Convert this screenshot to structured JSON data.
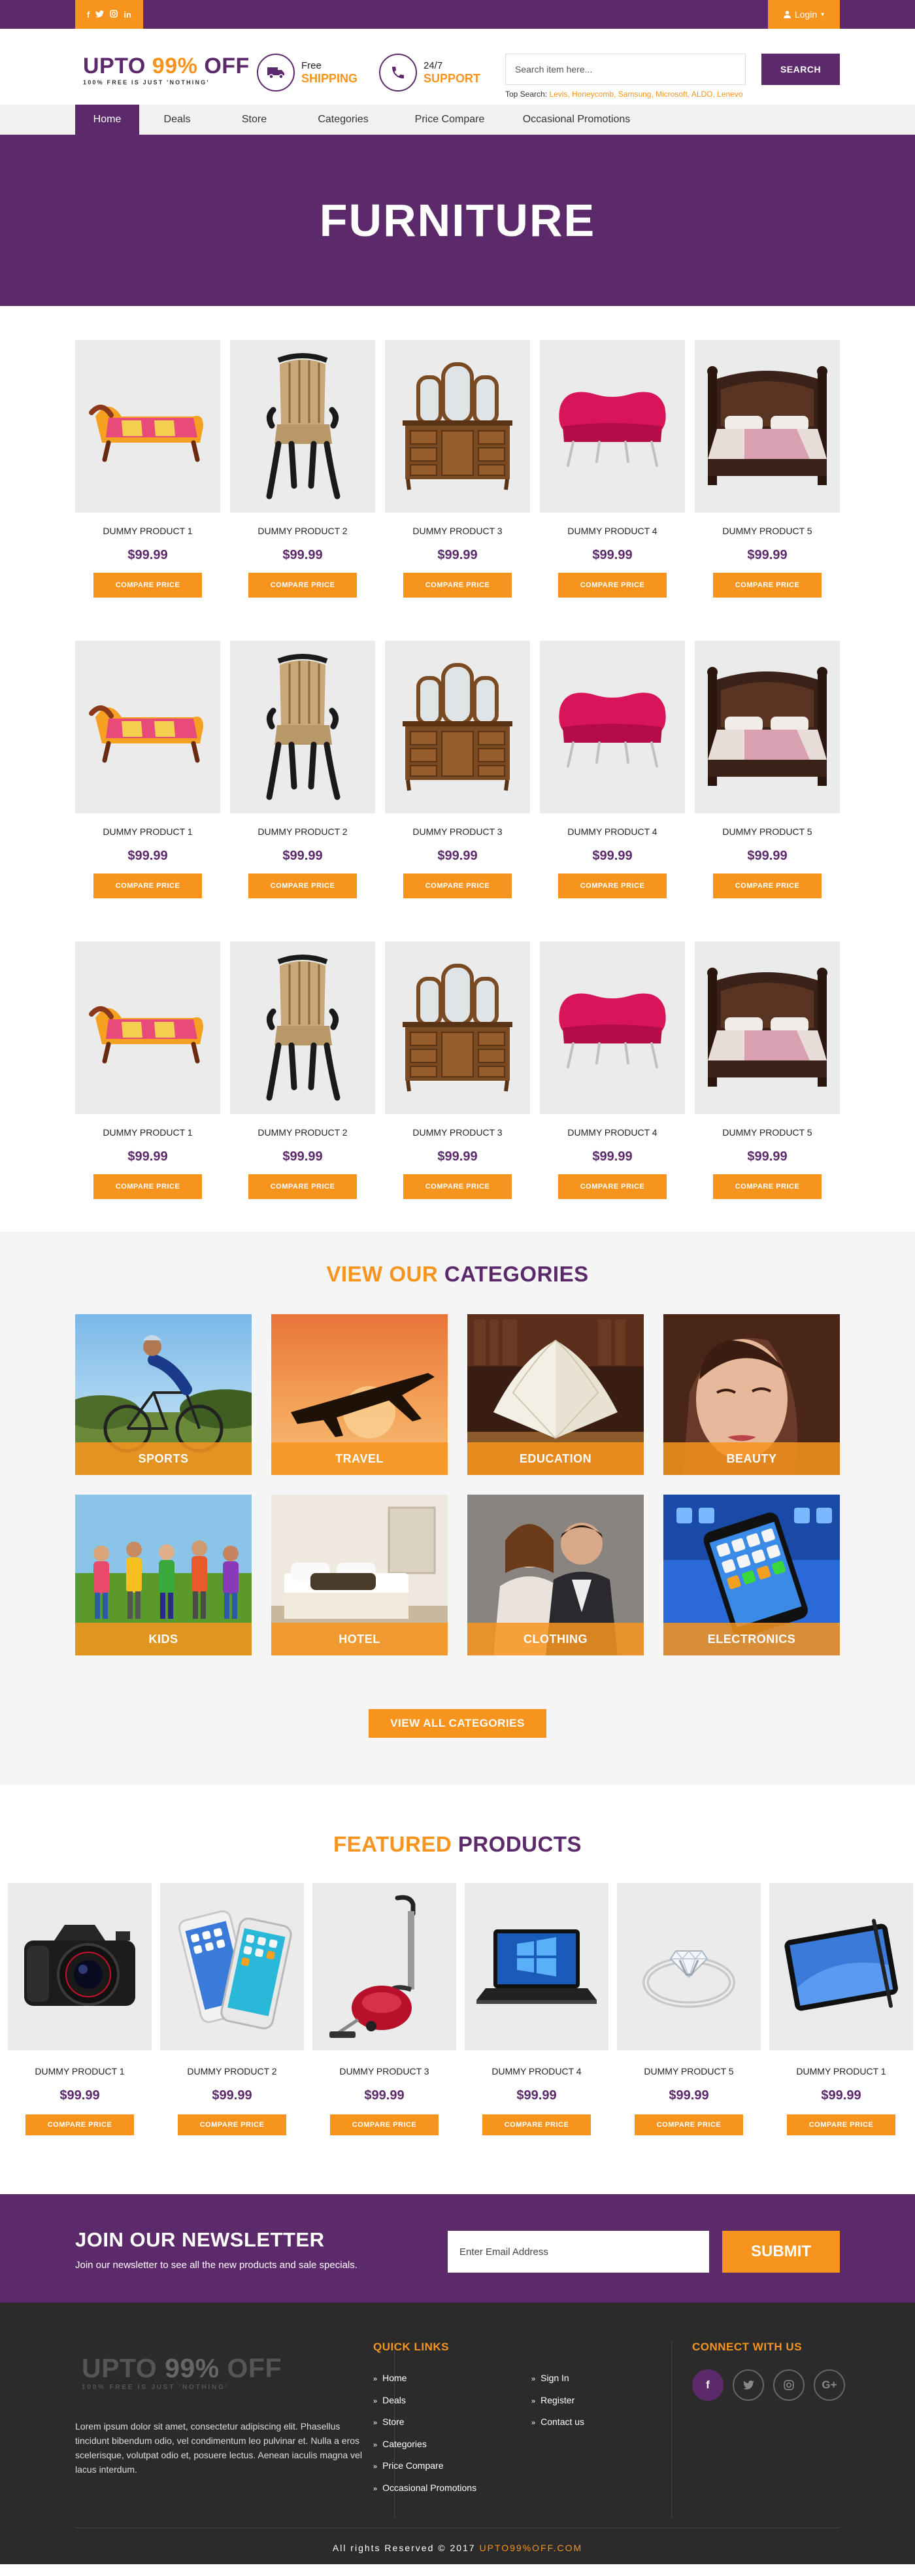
{
  "topbar": {
    "social": [
      "f",
      "t",
      "ig",
      "in"
    ],
    "login_label": "Login",
    "login_caret": "▾"
  },
  "header": {
    "logo_upto": "UPTO",
    "logo_pct": "99%",
    "logo_off": "OFF",
    "logo_tagline": "100% FREE IS JUST 'NOTHING'",
    "shipping_line1": "Free",
    "shipping_line2": "SHIPPING",
    "support_line1": "24/7",
    "support_line2": "SUPPORT",
    "search_placeholder": "Search item here...",
    "search_button": "SEARCH",
    "top_search_label": "Top Search:",
    "top_search_links": "Levis, Honeycomb, Samsung, Microsoft, ALDO, Lenevo"
  },
  "nav": {
    "items": [
      "Home",
      "Deals",
      "Store",
      "Categories",
      "Price Compare",
      "Occasional Promotions"
    ],
    "active": "Home"
  },
  "hero": {
    "title": "FURNITURE"
  },
  "products": [
    {
      "name": "DUMMY PRODUCT 1",
      "price": "$99.99",
      "button": "COMPARE PRICE",
      "icon": "chaise-lounge"
    },
    {
      "name": "DUMMY PRODUCT 2",
      "price": "$99.99",
      "button": "COMPARE PRICE",
      "icon": "armchair"
    },
    {
      "name": "DUMMY PRODUCT 3",
      "price": "$99.99",
      "button": "COMPARE PRICE",
      "icon": "dresser-mirror"
    },
    {
      "name": "DUMMY PRODUCT 4",
      "price": "$99.99",
      "button": "COMPARE PRICE",
      "icon": "pink-sofa"
    },
    {
      "name": "DUMMY PRODUCT 5",
      "price": "$99.99",
      "button": "COMPARE PRICE",
      "icon": "bed"
    }
  ],
  "categories": {
    "title_a": "VIEW OUR",
    "title_b": "CATEGORIES",
    "items": [
      "SPORTS",
      "TRAVEL",
      "EDUCATION",
      "BEAUTY",
      "KIDS",
      "HOTEL",
      "CLOTHING",
      "ELECTRONICS"
    ],
    "view_all": "VIEW ALL CATEGORIES"
  },
  "featured": {
    "title_a": "FEATURED",
    "title_b": "PRODUCTS",
    "items": [
      {
        "name": "DUMMY PRODUCT 1",
        "price": "$99.99",
        "button": "COMPARE PRICE",
        "icon": "camera"
      },
      {
        "name": "DUMMY PRODUCT 2",
        "price": "$99.99",
        "button": "COMPARE PRICE",
        "icon": "smartphones"
      },
      {
        "name": "DUMMY PRODUCT 3",
        "price": "$99.99",
        "button": "COMPARE PRICE",
        "icon": "vacuum-cleaner"
      },
      {
        "name": "DUMMY PRODUCT 4",
        "price": "$99.99",
        "button": "COMPARE PRICE",
        "icon": "laptop"
      },
      {
        "name": "DUMMY PRODUCT 5",
        "price": "$99.99",
        "button": "COMPARE PRICE",
        "icon": "diamond-ring"
      },
      {
        "name": "DUMMY PRODUCT 1",
        "price": "$99.99",
        "button": "COMPARE PRICE",
        "icon": "tablet"
      }
    ]
  },
  "newsletter": {
    "title": "JOIN OUR NEWSLETTER",
    "text": "Join our newsletter to see all the new products and sale specials.",
    "placeholder": "Enter Email Address",
    "button": "SUBMIT"
  },
  "footer": {
    "about": "Lorem ipsum dolor sit amet, consectetur adipiscing elit. Phasellus tincidunt bibendum odio, vel condimentum leo pulvinar et. Nulla a eros scelerisque, volutpat odio et, posuere lectus. Aenean iaculis magna vel lacus interdum.",
    "quick_links_title": "QUICK LINKS",
    "quick_links": [
      "Home",
      "Deals",
      "Store",
      "Categories",
      "Price Compare",
      "Occasional Promotions"
    ],
    "account_links": [
      "Sign In",
      "Register",
      "Contact us"
    ],
    "connect_title": "CONNECT WITH US",
    "social": [
      "f",
      "t",
      "ig",
      "G+"
    ],
    "copyright": "All rights Reserved © 2017",
    "site": "UPTO99%OFF.COM"
  },
  "colors": {
    "purple": "#5c2a6b",
    "orange": "#f7941d",
    "footer_bg": "#2b2b2b"
  }
}
